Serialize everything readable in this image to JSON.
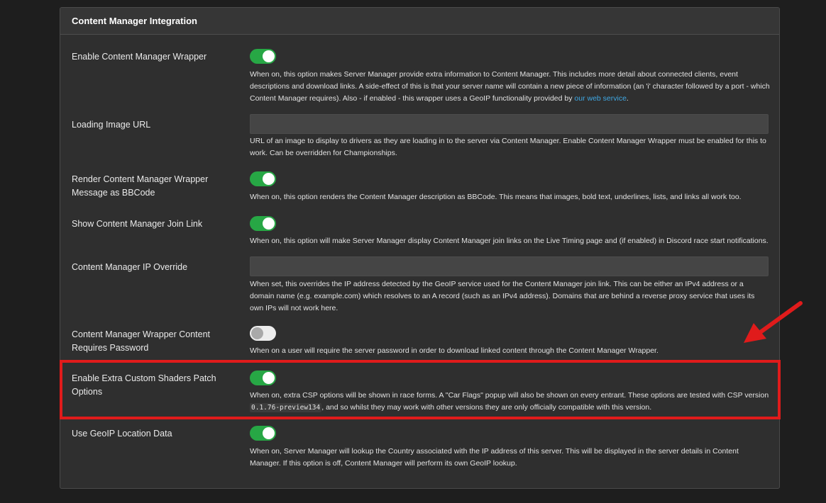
{
  "panel": {
    "title": "Content Manager Integration"
  },
  "settings": {
    "cm_wrapper": {
      "label": "Enable Content Manager Wrapper",
      "state": "on",
      "desc_before_link": "When on, this option makes Server Manager provide extra information to Content Manager. This includes more detail about connected clients, event descriptions and download links. A side-effect of this is that your server name will contain a new piece of information (an 'i' character followed by a port - which Content Manager requires). Also - if enabled - this wrapper uses a GeoIP functionality provided by ",
      "desc_link": "our web service",
      "desc_after_link": "."
    },
    "loading_image": {
      "label": "Loading Image URL",
      "value": "",
      "desc": "URL of an image to display to drivers as they are loading in to the server via Content Manager. Enable Content Manager Wrapper must be enabled for this to work. Can be overridden for Championships."
    },
    "bbcode": {
      "label": "Render Content Manager Wrapper Message as BBCode",
      "state": "on",
      "desc": "When on, this option renders the Content Manager description as BBCode. This means that images, bold text, underlines, lists, and links all work too."
    },
    "join_link": {
      "label": "Show Content Manager Join Link",
      "state": "on",
      "desc": "When on, this option will make Server Manager display Content Manager join links on the Live Timing page and (if enabled) in Discord race start notifications."
    },
    "ip_override": {
      "label": "Content Manager IP Override",
      "value": "",
      "desc": "When set, this overrides the IP address detected by the GeoIP service used for the Content Manager join link. This can be either an IPv4 address or a domain name (e.g. example.com) which resolves to an A record (such as an IPv4 address). Domains that are behind a reverse proxy service that uses its own IPs will not work here."
    },
    "requires_password": {
      "label": "Content Manager Wrapper Content Requires Password",
      "state": "off",
      "desc": "When on a user will require the server password in order to download linked content through the Content Manager Wrapper."
    },
    "csp": {
      "label": "Enable Extra Custom Shaders Patch Options",
      "state": "on",
      "desc_before_code": "When on, extra CSP options will be shown in race forms. A \"Car Flags\" popup will also be shown on every entrant. These options are tested with CSP version ",
      "desc_code": "0.1.76-preview134",
      "desc_after_code": ", and so whilst they may work with other versions they are only officially compatible with this version."
    },
    "geoip": {
      "label": "Use GeoIP Location Data",
      "state": "on",
      "desc": "When on, Server Manager will lookup the Country associated with the IP address of this server. This will be displayed in the server details in Content Manager. If this option is off, Content Manager will perform its own GeoIP lookup."
    }
  },
  "colors": {
    "toggle_on": "#27a745",
    "toggle_off": "#ededed",
    "link": "#3fa8e4",
    "annotation": "#e01b1b"
  }
}
